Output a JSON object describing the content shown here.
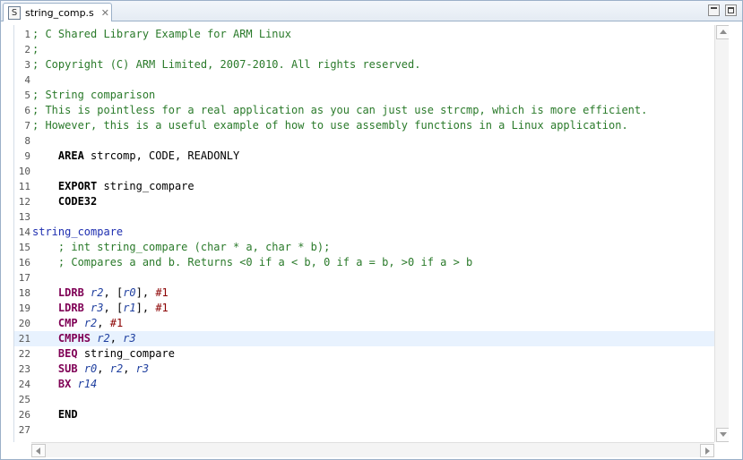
{
  "tab": {
    "icon_letter": "S",
    "label": "string_comp.s"
  },
  "lines": [
    {
      "n": "1",
      "tokens": [
        {
          "t": "; C Shared Library Example for ARM Linux",
          "c": "comment"
        }
      ]
    },
    {
      "n": "2",
      "tokens": [
        {
          "t": ";",
          "c": "comment"
        }
      ]
    },
    {
      "n": "3",
      "tokens": [
        {
          "t": "; Copyright (C) ARM Limited, 2007-2010. All rights reserved.",
          "c": "comment"
        }
      ]
    },
    {
      "n": "4",
      "tokens": []
    },
    {
      "n": "5",
      "tokens": [
        {
          "t": "; String comparison",
          "c": "comment"
        }
      ]
    },
    {
      "n": "6",
      "tokens": [
        {
          "t": "; This is pointless for a real application as you can just use strcmp, which is more efficient.",
          "c": "comment"
        }
      ]
    },
    {
      "n": "7",
      "tokens": [
        {
          "t": "; However, this is a useful example of how to use assembly functions in a Linux application.",
          "c": "comment"
        }
      ]
    },
    {
      "n": "8",
      "tokens": []
    },
    {
      "n": "9",
      "tokens": [
        {
          "t": "    ",
          "c": ""
        },
        {
          "t": "AREA",
          "c": "kw"
        },
        {
          "t": " strcomp, CODE, READONLY",
          "c": ""
        }
      ]
    },
    {
      "n": "10",
      "tokens": []
    },
    {
      "n": "11",
      "tokens": [
        {
          "t": "    ",
          "c": ""
        },
        {
          "t": "EXPORT",
          "c": "kw"
        },
        {
          "t": " string_compare",
          "c": ""
        }
      ]
    },
    {
      "n": "12",
      "tokens": [
        {
          "t": "    ",
          "c": ""
        },
        {
          "t": "CODE32",
          "c": "kw"
        }
      ]
    },
    {
      "n": "13",
      "tokens": []
    },
    {
      "n": "14",
      "tokens": [
        {
          "t": "string_compare",
          "c": "label"
        }
      ]
    },
    {
      "n": "15",
      "tokens": [
        {
          "t": "    ; int string_compare (char * a, char * b);",
          "c": "comment"
        }
      ]
    },
    {
      "n": "16",
      "tokens": [
        {
          "t": "    ; Compares a and b. Returns <0 if a < b, 0 if a = b, >0 if a > b",
          "c": "comment"
        }
      ]
    },
    {
      "n": "17",
      "tokens": []
    },
    {
      "n": "18",
      "tokens": [
        {
          "t": "    ",
          "c": ""
        },
        {
          "t": "LDRB",
          "c": "kw2"
        },
        {
          "t": " ",
          "c": ""
        },
        {
          "t": "r2",
          "c": "reg"
        },
        {
          "t": ", [",
          "c": ""
        },
        {
          "t": "r0",
          "c": "reg"
        },
        {
          "t": "], ",
          "c": ""
        },
        {
          "t": "#1",
          "c": "imm"
        }
      ]
    },
    {
      "n": "19",
      "tokens": [
        {
          "t": "    ",
          "c": ""
        },
        {
          "t": "LDRB",
          "c": "kw2"
        },
        {
          "t": " ",
          "c": ""
        },
        {
          "t": "r3",
          "c": "reg"
        },
        {
          "t": ", [",
          "c": ""
        },
        {
          "t": "r1",
          "c": "reg"
        },
        {
          "t": "], ",
          "c": ""
        },
        {
          "t": "#1",
          "c": "imm"
        }
      ]
    },
    {
      "n": "20",
      "tokens": [
        {
          "t": "    ",
          "c": ""
        },
        {
          "t": "CMP",
          "c": "kw2"
        },
        {
          "t": " ",
          "c": ""
        },
        {
          "t": "r2",
          "c": "reg"
        },
        {
          "t": ", ",
          "c": ""
        },
        {
          "t": "#1",
          "c": "imm"
        }
      ]
    },
    {
      "n": "21",
      "current": true,
      "tokens": [
        {
          "t": "    ",
          "c": ""
        },
        {
          "t": "CMPHS",
          "c": "kw2"
        },
        {
          "t": " ",
          "c": ""
        },
        {
          "t": "r2",
          "c": "reg"
        },
        {
          "t": ", ",
          "c": ""
        },
        {
          "t": "r3",
          "c": "reg"
        }
      ]
    },
    {
      "n": "22",
      "tokens": [
        {
          "t": "    ",
          "c": ""
        },
        {
          "t": "BEQ",
          "c": "kw2"
        },
        {
          "t": " string_compare",
          "c": ""
        }
      ]
    },
    {
      "n": "23",
      "tokens": [
        {
          "t": "    ",
          "c": ""
        },
        {
          "t": "SUB",
          "c": "kw2"
        },
        {
          "t": " ",
          "c": ""
        },
        {
          "t": "r0",
          "c": "reg"
        },
        {
          "t": ", ",
          "c": ""
        },
        {
          "t": "r2",
          "c": "reg"
        },
        {
          "t": ", ",
          "c": ""
        },
        {
          "t": "r3",
          "c": "reg"
        }
      ]
    },
    {
      "n": "24",
      "tokens": [
        {
          "t": "    ",
          "c": ""
        },
        {
          "t": "BX",
          "c": "kw2"
        },
        {
          "t": " ",
          "c": ""
        },
        {
          "t": "r14",
          "c": "reg"
        }
      ]
    },
    {
      "n": "25",
      "tokens": []
    },
    {
      "n": "26",
      "tokens": [
        {
          "t": "    ",
          "c": ""
        },
        {
          "t": "END",
          "c": "kw"
        }
      ]
    },
    {
      "n": "27",
      "tokens": []
    }
  ]
}
